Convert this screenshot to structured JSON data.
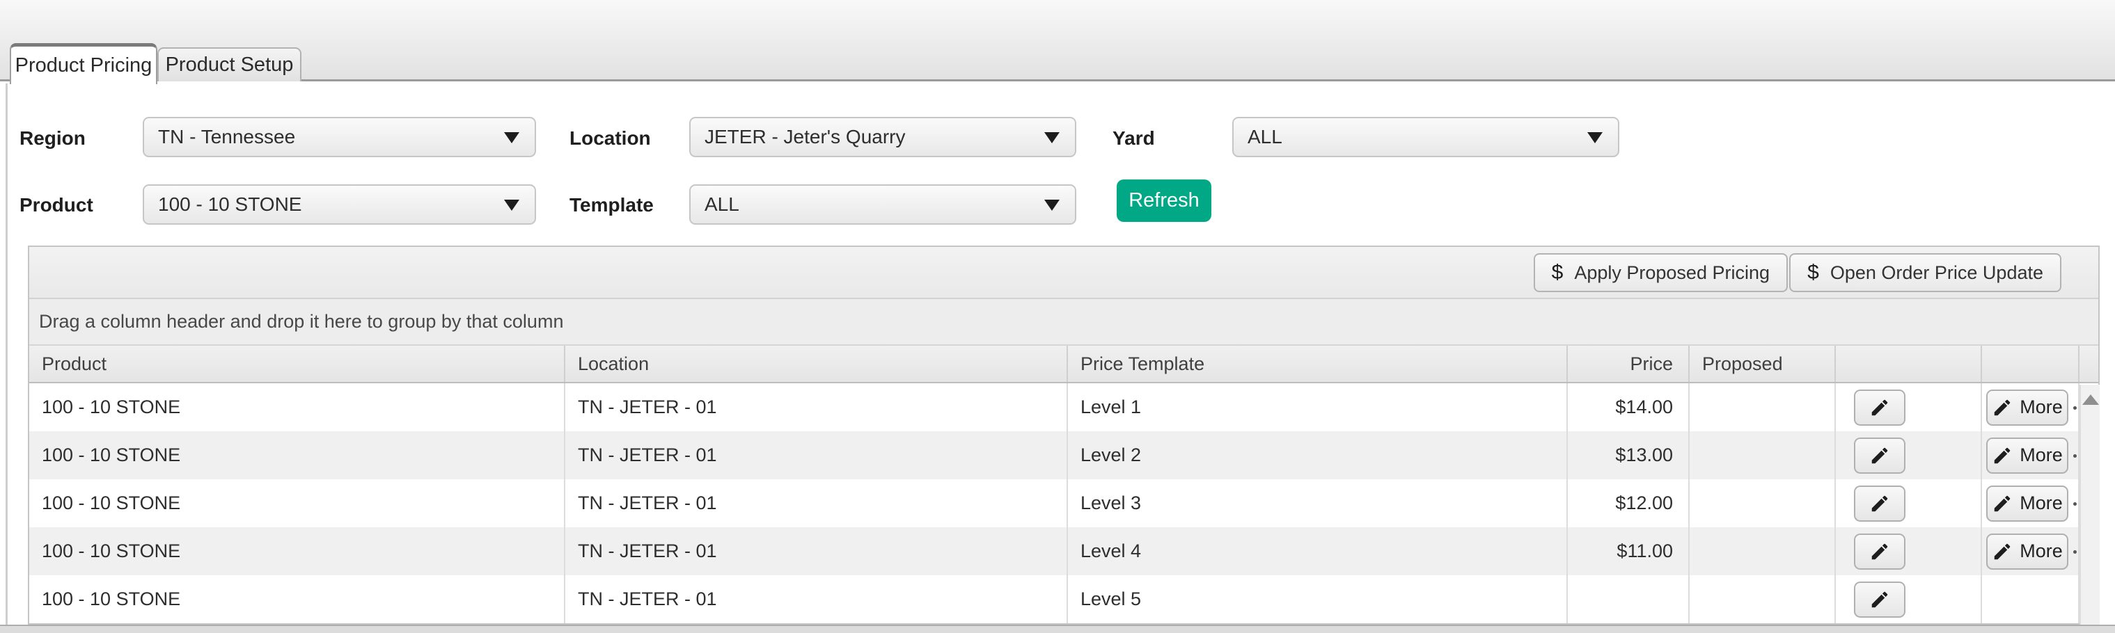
{
  "tabs": {
    "product_pricing": "Product Pricing",
    "product_setup": "Product Setup"
  },
  "filters": {
    "region": {
      "label": "Region",
      "value": "TN - Tennessee"
    },
    "location": {
      "label": "Location",
      "value": "JETER - Jeter's Quarry"
    },
    "yard": {
      "label": "Yard",
      "value": "ALL"
    },
    "product": {
      "label": "Product",
      "value": "100 - 10 STONE"
    },
    "template": {
      "label": "Template",
      "value": "ALL"
    },
    "refresh_label": "Refresh"
  },
  "toolbar": {
    "dollar_icon": "$",
    "apply_proposed_label": "Apply Proposed Pricing",
    "open_order_label": "Open Order Price Update"
  },
  "grid": {
    "group_hint": "Drag a column header and drop it here to group by that column",
    "columns": [
      "Product",
      "Location",
      "Price Template",
      "Price",
      "Proposed"
    ],
    "more_label": "More",
    "rows": [
      {
        "product": "100 - 10 STONE",
        "location": "TN - JETER - 01",
        "price_template": "Level 1",
        "price": "$14.00",
        "proposed": "",
        "has_more": true
      },
      {
        "product": "100 - 10 STONE",
        "location": "TN - JETER - 01",
        "price_template": "Level 2",
        "price": "$13.00",
        "proposed": "",
        "has_more": true
      },
      {
        "product": "100 - 10 STONE",
        "location": "TN - JETER - 01",
        "price_template": "Level 3",
        "price": "$12.00",
        "proposed": "",
        "has_more": true
      },
      {
        "product": "100 - 10 STONE",
        "location": "TN - JETER - 01",
        "price_template": "Level 4",
        "price": "$11.00",
        "proposed": "",
        "has_more": true
      },
      {
        "product": "100 - 10 STONE",
        "location": "TN - JETER - 01",
        "price_template": "Level 5",
        "price": "",
        "proposed": "",
        "has_more": false
      }
    ]
  },
  "colors": {
    "accent_green": "#00a886"
  }
}
